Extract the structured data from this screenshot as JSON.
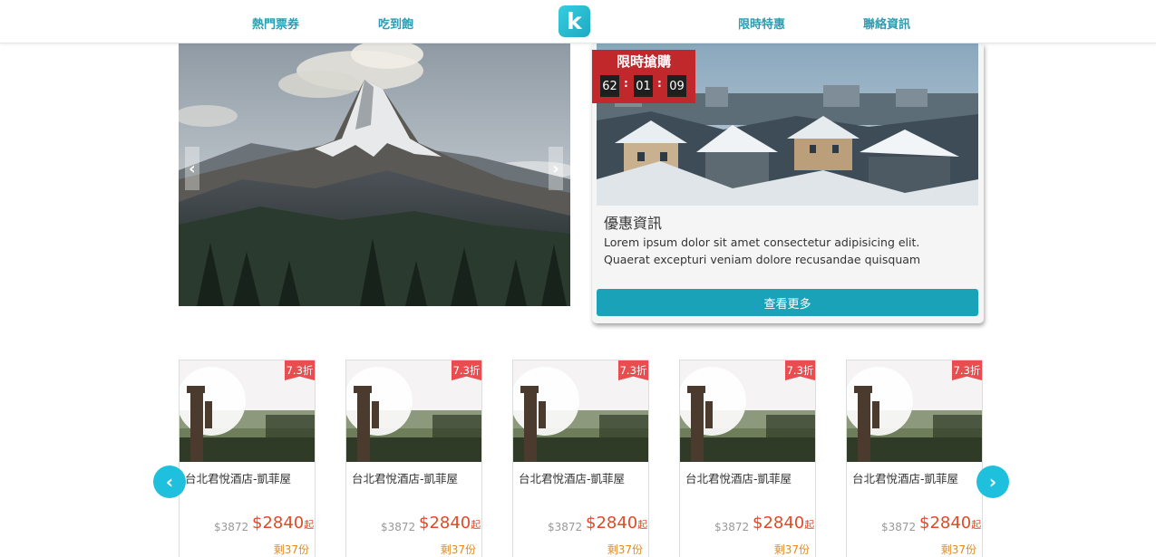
{
  "nav": {
    "hot_tickets": "熱門票券",
    "buffet": "吃到飽",
    "logo_letter": "k",
    "limited_offer": "限時特惠",
    "contact": "聯絡資訊"
  },
  "hero": {
    "prev_icon": "‹",
    "next_icon": "›"
  },
  "promo": {
    "flash_title": "限時搶購",
    "countdown": {
      "hours": "62",
      "minutes": "01",
      "seconds": "09",
      "sep": ":"
    },
    "title": "優惠資訊",
    "description": "Lorem ipsum dolor sit amet consectetur adipisicing elit. Quaerat excepturi veniam dolore recusandae quisquam",
    "more_button": "查看更多"
  },
  "products": {
    "prev_icon": "‹",
    "next_icon": "›",
    "items": [
      {
        "discount": "7.3折",
        "name": "台北君悅酒店-凱菲屋",
        "original_price": "$3872",
        "price": "$2840",
        "price_suffix": "起",
        "remaining": "剩37份"
      },
      {
        "discount": "7.3折",
        "name": "台北君悅酒店-凱菲屋",
        "original_price": "$3872",
        "price": "$2840",
        "price_suffix": "起",
        "remaining": "剩37份"
      },
      {
        "discount": "7.3折",
        "name": "台北君悅酒店-凱菲屋",
        "original_price": "$3872",
        "price": "$2840",
        "price_suffix": "起",
        "remaining": "剩37份"
      },
      {
        "discount": "7.3折",
        "name": "台北君悅酒店-凱菲屋",
        "original_price": "$3872",
        "price": "$2840",
        "price_suffix": "起",
        "remaining": "剩37份"
      },
      {
        "discount": "7.3折",
        "name": "台北君悅酒店-凱菲屋",
        "original_price": "$3872",
        "price": "$2840",
        "price_suffix": "起",
        "remaining": "剩37份"
      }
    ]
  },
  "colors": {
    "accent": "#1aa3b8",
    "nav_text": "#2a9db1",
    "flash_red": "#c0282b",
    "ribbon_red": "#ea4d4f",
    "price_red": "#e04a2a",
    "remaining_orange": "#e58a1e",
    "arrow_cyan": "#1fc0de"
  }
}
